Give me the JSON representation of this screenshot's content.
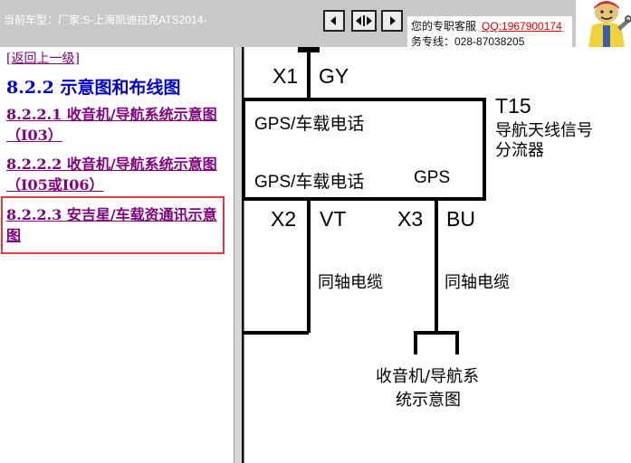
{
  "header": {
    "car_info": "当前车型：厂家:S-上海凯迪拉克ATS2014-",
    "support_label": "您的专职客服",
    "qq": "QQ:1967900174",
    "hotline": "务专线：028-87038205"
  },
  "nav_buttons": [
    {
      "icon": "arrow-left-icon"
    },
    {
      "icon": "arrows-expand-icon"
    },
    {
      "icon": "arrow-right-icon"
    }
  ],
  "left_pane": {
    "back_link": "[返回上一级]",
    "section_title": "8.2.2 示意图和布线图",
    "items": [
      {
        "label": "8.2.2.1 收音机/导航系统示意图（I03）",
        "selected": false
      },
      {
        "label": "8.2.2.2 收音机/导航系统示意图（I05或I06）",
        "selected": false
      },
      {
        "label": "8.2.2.3 安吉星/车载资通讯示意图",
        "selected": true
      }
    ]
  },
  "diagram": {
    "x1": "X1",
    "gy": "GY",
    "t15": "T15",
    "t15_desc_1": "导航天线信号",
    "t15_desc_2": "分流器",
    "box_line1": "GPS/车载电话",
    "box_line2": "GPS/车载电话",
    "box_gps": "GPS",
    "x2": "X2",
    "vt": "VT",
    "x3": "X3",
    "bu": "BU",
    "cable_left": "同轴电缆",
    "cable_right": "同轴电缆",
    "target_1": "收音机/导航系",
    "target_2": "统示意图"
  },
  "colors": {
    "topbar": "#c9c9c9",
    "link": "#800080",
    "section_title": "#0000cc",
    "highlight": "#e53b3b",
    "qq": "#e00000"
  }
}
